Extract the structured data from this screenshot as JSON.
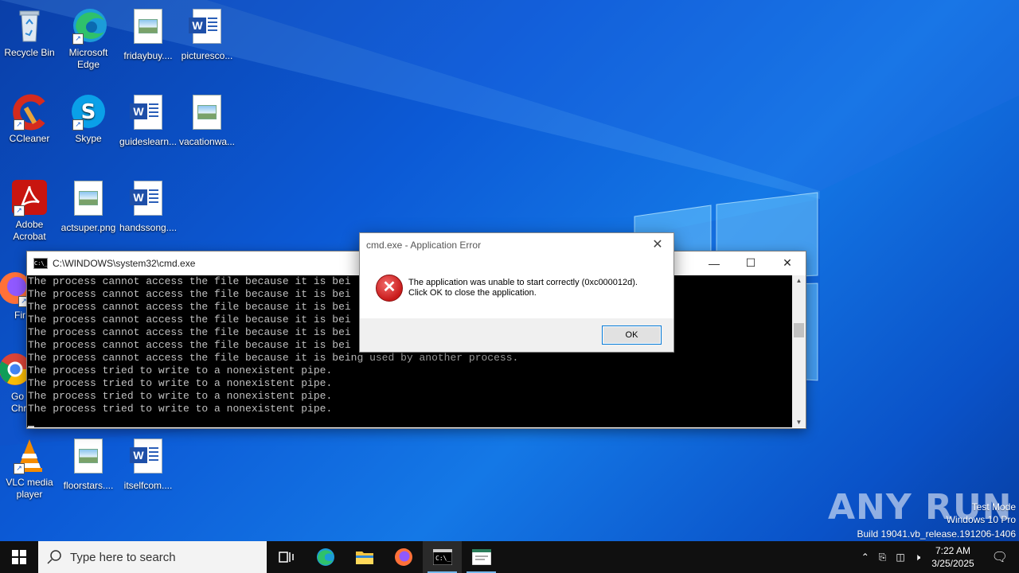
{
  "desktop": {
    "icons": [
      {
        "label": "Recycle Bin",
        "icon": "recycle-bin-icon"
      },
      {
        "label": "Microsoft Edge",
        "icon": "edge-icon"
      },
      {
        "label": "fridaybuy....",
        "icon": "image-file-icon"
      },
      {
        "label": "picturesco...",
        "icon": "word-file-icon"
      },
      {
        "label": "CCleaner",
        "icon": "ccleaner-icon"
      },
      {
        "label": "Skype",
        "icon": "skype-icon"
      },
      {
        "label": "guideslearn...",
        "icon": "word-file-icon"
      },
      {
        "label": "vacationwa...",
        "icon": "image-file-icon"
      },
      {
        "label": "Adobe Acrobat",
        "icon": "acrobat-icon"
      },
      {
        "label": "actsuper.png",
        "icon": "image-file-icon"
      },
      {
        "label": "handssong....",
        "icon": "word-file-icon"
      },
      {
        "label": "Fir",
        "icon": "firefox-icon"
      },
      {
        "label": "Go Chr",
        "icon": "chrome-icon"
      },
      {
        "label": "VLC media player",
        "icon": "vlc-icon"
      },
      {
        "label": "floorstars....",
        "icon": "image-file-icon"
      },
      {
        "label": "itselfcom....",
        "icon": "word-file-icon"
      }
    ]
  },
  "cmd_window": {
    "title": "C:\\WINDOWS\\system32\\cmd.exe",
    "icon_text": "C:\\_",
    "lines": [
      "The process cannot access the file because it is bei",
      "The process cannot access the file because it is bei",
      "The process cannot access the file because it is bei",
      "The process cannot access the file because it is bei",
      "The process cannot access the file because it is bei",
      "The process cannot access the file because it is bei",
      "The process cannot access the file because it is being used by another process.",
      "The process tried to write to a nonexistent pipe.",
      "The process tried to write to a nonexistent pipe.",
      "The process tried to write to a nonexistent pipe.",
      "The process tried to write to a nonexistent pipe."
    ]
  },
  "dialog": {
    "title": "cmd.exe - Application Error",
    "message_line1": "The application was unable to start correctly (0xc000012d).",
    "message_line2": "Click OK to close the application.",
    "ok_label": "OK"
  },
  "watermark": {
    "brand": "ANY RUN",
    "line1": "Test Mode",
    "line2": "Windows 10 Pro",
    "line3": "Build 19041.vb_release.191206-1406"
  },
  "taskbar": {
    "search_placeholder": "Type here to search",
    "time": "7:22 AM",
    "date": "3/25/2025",
    "accent": "#76b9ed"
  }
}
